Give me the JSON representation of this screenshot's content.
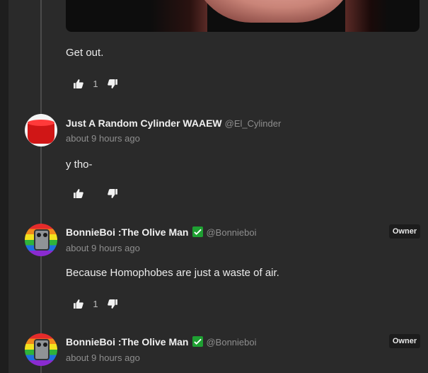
{
  "comments": [
    {
      "text": "Get out.",
      "like_count": "1"
    },
    {
      "username": "Just A Random Cylinder WAAEW",
      "handle": "@El_Cylinder",
      "timestamp": "about 9 hours ago",
      "text": "y tho-",
      "avatar_icon": "red-cylinder-avatar"
    },
    {
      "username": "BonnieBoi :The Olive Man",
      "handle": "@Bonnieboi",
      "badge": "Owner",
      "timestamp": "about 9 hours ago",
      "text": "Because Homophobes are just a waste of air.",
      "like_count": "1",
      "avatar_icon": "rainbow-robot-avatar"
    },
    {
      "username": "BonnieBoi :The Olive Man",
      "handle": "@Bonnieboi",
      "badge": "Owner",
      "timestamp": "about 9 hours ago",
      "avatar_icon": "rainbow-robot-avatar"
    }
  ],
  "icons": {
    "like": "thumbs-up-icon",
    "dislike": "thumbs-down-icon",
    "verified": "verified-check-icon"
  },
  "colors": {
    "background": "#2a2a2a",
    "verified": "#1ea032",
    "badge_bg": "#1c1c1c"
  }
}
